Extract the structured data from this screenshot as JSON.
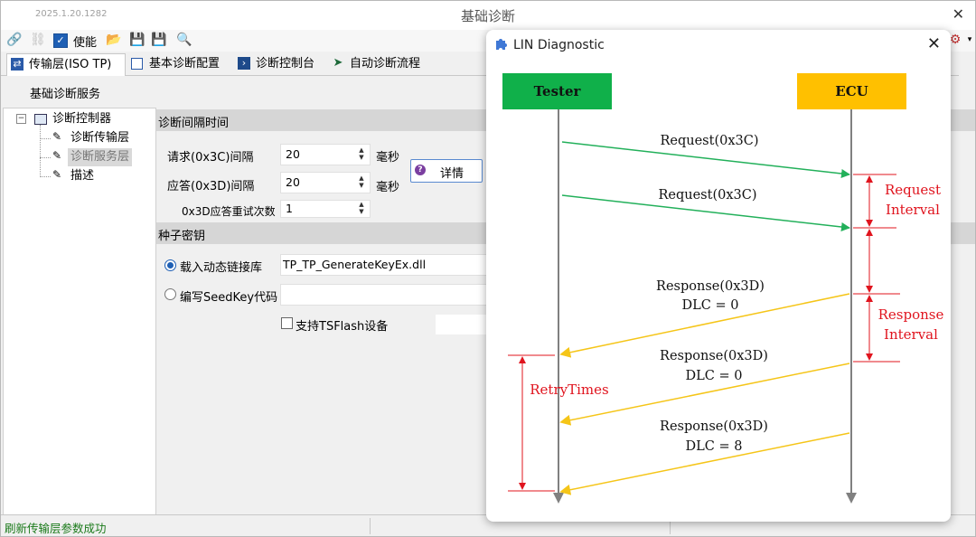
{
  "window": {
    "version": "2025.1.20.1282",
    "title": "基础诊断"
  },
  "toolbar": {
    "enable_label": "使能"
  },
  "tabs": [
    {
      "label": "传输层(ISO TP)"
    },
    {
      "label": "基本诊断配置"
    },
    {
      "label": "诊断控制台"
    },
    {
      "label": "自动诊断流程"
    }
  ],
  "subheader": "基础诊断服务",
  "tree": {
    "root": "诊断控制器",
    "items": [
      "诊断传输层",
      "诊断服务层",
      "描述"
    ]
  },
  "interval_section": {
    "title": "诊断间隔时间",
    "request_label": "请求(0x3C)间隔",
    "request_value": "20",
    "request_unit": "毫秒",
    "response_label": "应答(0x3D)间隔",
    "response_value": "20",
    "response_unit": "毫秒",
    "retry_label": "0x3D应答重试次数",
    "retry_value": "1",
    "detail_button": "详情"
  },
  "seed_section": {
    "title": "种子密钥",
    "load_dll_label": "载入动态链接库",
    "dll_value": "TP_TP_GenerateKeyEx.dll",
    "write_code_label": "编写SeedKey代码",
    "tsflash_label": "支持TSFlash设备"
  },
  "status": {
    "message": "刷新传输层参数成功"
  },
  "popup": {
    "title": "LIN Diagnostic",
    "tester_label": "Tester",
    "ecu_label": "ECU",
    "msg1": "Request(0x3C)",
    "msg2": "Request(0x3C)",
    "msg3_line1": "Response(0x3D)",
    "msg3_line2": "DLC = 0",
    "msg4_line1": "Response(0x3D)",
    "msg4_line2": "DLC = 0",
    "msg5_line1": "Response(0x3D)",
    "msg5_line2": "DLC = 8",
    "request_interval_1": "Request",
    "request_interval_2": "Interval",
    "response_interval_1": "Response",
    "response_interval_2": "Interval",
    "retry_times": "RetryTimes",
    "colors": {
      "tester": "#10b04a",
      "ecu": "#ffc000",
      "request_arrow": "#22b05a",
      "response_arrow": "#f5c518",
      "annotation": "#e0141e"
    }
  }
}
